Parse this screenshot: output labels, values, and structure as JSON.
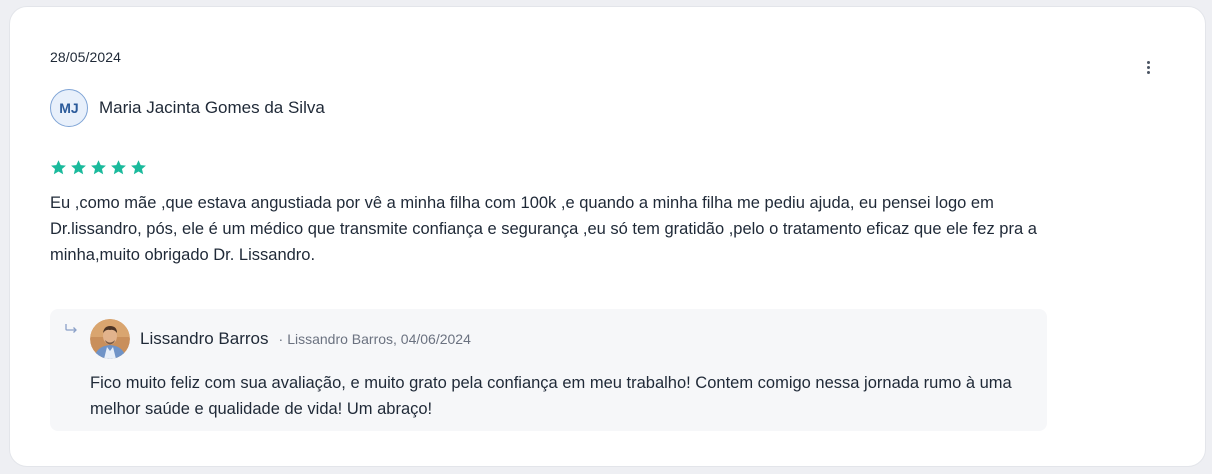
{
  "review": {
    "date": "28/05/2024",
    "author_initials": "MJ",
    "author_name": "Maria Jacinta Gomes da Silva",
    "rating": 5,
    "max_rating": 5,
    "text": "Eu ,como mãe ,que estava angustiada por vê a minha filha com 100k ,e quando a minha filha me pediu ajuda, eu pensei logo em Dr.lissandro, pós, ele é um médico que transmite confiança e segurança ,eu só tem gratidão ,pelo o tratamento eficaz que ele fez pra a minha,muito obrigado Dr. Lissandro.",
    "menu_icon": "more-vertical-icon"
  },
  "reply": {
    "icon": "reply-arrow-icon",
    "author_name": "Lissandro Barros",
    "separator": "·",
    "meta": "Lissandro Barros, 04/06/2024",
    "text": "Fico muito feliz com sua avaliação, e muito grato pela confiança em meu trabalho! Contem comigo nessa jornada rumo à uma melhor saúde e qualidade de vida! Um abraço!"
  },
  "colors": {
    "star": "#1aba9c",
    "card_bg": "#ffffff",
    "page_bg": "#eeeff3",
    "reply_bg": "#f6f7f9",
    "initials_border": "#7fa4d6",
    "initials_text": "#2a5a9a"
  }
}
